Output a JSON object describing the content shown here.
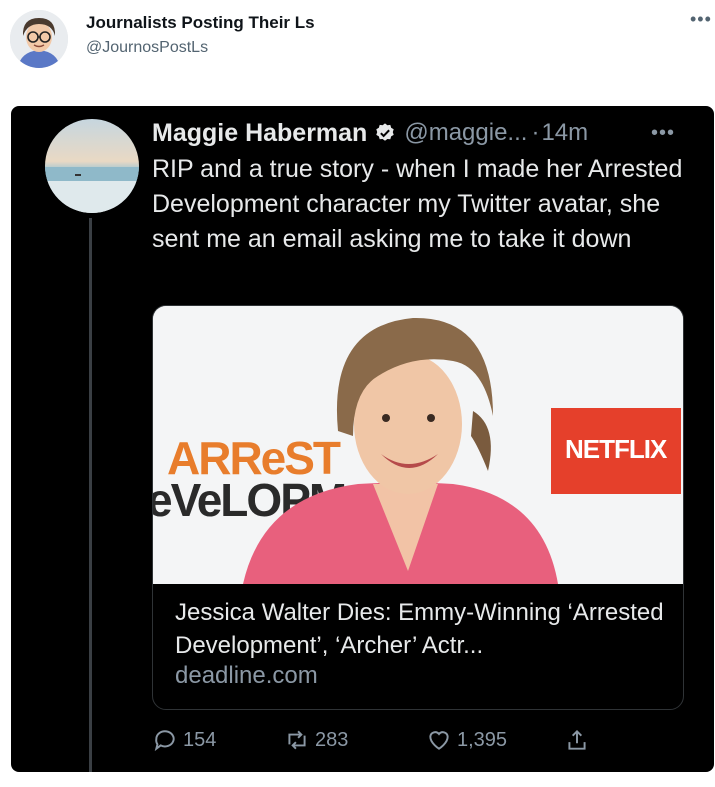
{
  "outer": {
    "account_name": "Journalists Posting Their Ls",
    "account_handle": "@JournosPostLs",
    "more_icon": "more-icon"
  },
  "tweet": {
    "author_name": "Maggie Haberman",
    "verified": true,
    "author_handle": "@maggie...",
    "separator": "·",
    "time": "14m",
    "text": "RIP and a true story - when I made her Arrested Development character my Twitter avatar, she sent me an email asking me to take it down",
    "card": {
      "title": "Jessica Walter Dies: Emmy-Winning ‘Arrested Development’, ‘Archer’ Actr...",
      "domain": "deadline.com",
      "image_text_left_line1": "ARReST",
      "image_text_left_line2": "eVeLOPM",
      "image_text_right": "NETFLIX"
    },
    "actions": {
      "replies": "154",
      "retweets": "283",
      "likes": "1,395"
    }
  },
  "colors": {
    "dark_bg": "#000000",
    "text_primary_dark": "#e7e9ea",
    "text_secondary_dark": "#8b98a5",
    "verified_blue": "#1d9bf0",
    "netflix_red": "#e5402b",
    "arrested_orange": "#e87d2c",
    "blazer_pink": "#e8607d"
  }
}
